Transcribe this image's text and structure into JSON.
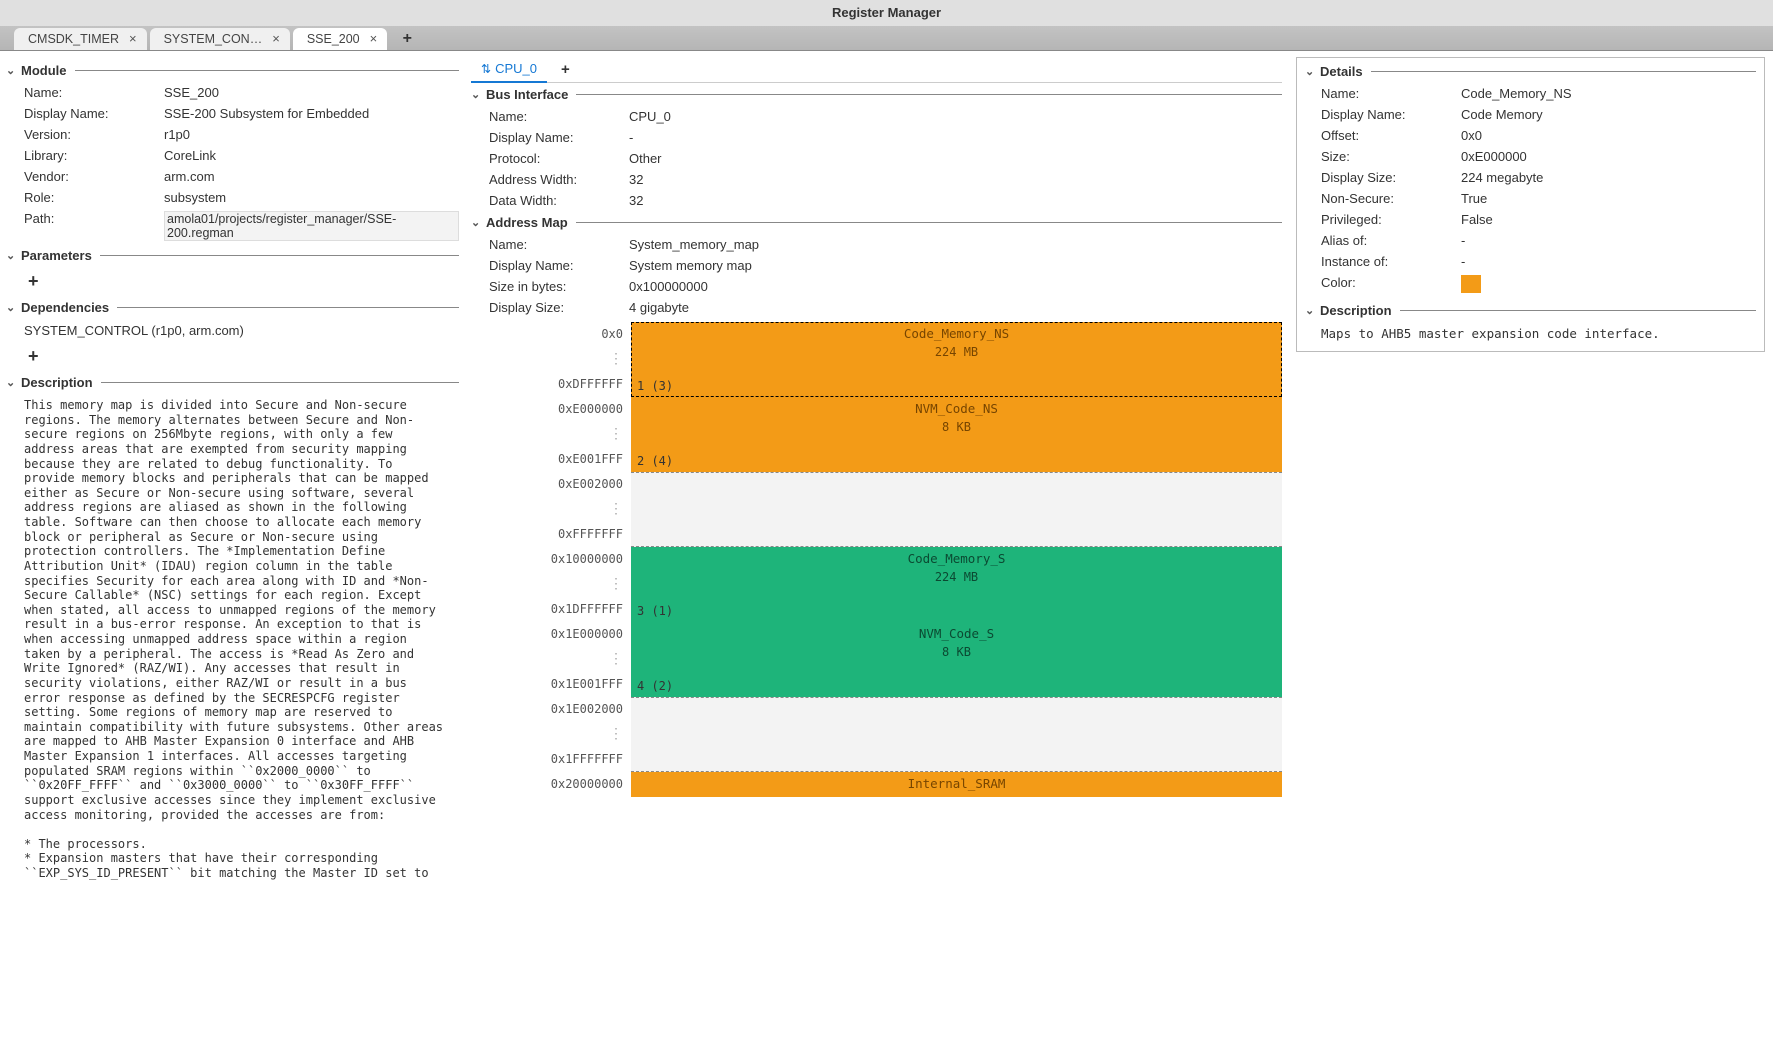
{
  "window": {
    "title": "Register Manager"
  },
  "tabs": [
    {
      "label": "CMSDK_TIMER",
      "active": false
    },
    {
      "label": "SYSTEM_CON…",
      "active": false
    },
    {
      "label": "SSE_200",
      "active": true
    }
  ],
  "module": {
    "header": "Module",
    "name_label": "Name:",
    "name": "SSE_200",
    "display_label": "Display Name:",
    "display": "SSE-200 Subsystem for Embedded",
    "version_label": "Version:",
    "version": "r1p0",
    "library_label": "Library:",
    "library": "CoreLink",
    "vendor_label": "Vendor:",
    "vendor": "arm.com",
    "role_label": "Role:",
    "role": "subsystem",
    "path_label": "Path:",
    "path": "amola01/projects/register_manager/SSE-200.regman"
  },
  "parameters": {
    "header": "Parameters"
  },
  "dependencies": {
    "header": "Dependencies",
    "item": "SYSTEM_CONTROL (r1p0, arm.com)"
  },
  "description": {
    "header": "Description",
    "text": "This memory map is divided into Secure and Non-secure regions. The memory alternates between Secure and Non-secure regions on 256Mbyte regions, with only a few address areas that are exempted from security mapping because they are related to debug functionality. To provide memory blocks and peripherals that can be mapped either as Secure or Non-secure using software, several address regions are aliased as shown in the following table. Software can then choose to allocate each memory block or peripheral as Secure or Non-secure using protection controllers. The *Implementation Define Attribution Unit* (IDAU) region column in the table specifies Security for each area along with ID and *Non-Secure Callable* (NSC) settings for each region. Except when stated, all access to unmapped regions of the memory result in a bus-error response. An exception to that is when accessing unmapped address space within a region taken by a peripheral. The access is *Read As Zero and Write Ignored* (RAZ/WI). Any accesses that result in security violations, either RAZ/WI or result in a bus error response as defined by the SECRESPCFG register setting. Some regions of memory map are reserved to maintain compatibility with future subsystems. Other areas are mapped to AHB Master Expansion 0 interface and AHB Master Expansion 1 interfaces. All accesses targeting populated SRAM regions within ``0x2000_0000`` to ``0x20FF_FFFF`` and ``0x3000_0000`` to ``0x30FF_FFFF`` support exclusive accesses since they implement exclusive access monitoring, provided the accesses are from:\n\n* The processors.\n* Expansion masters that have their corresponding ``EXP_SYS_ID_PRESENT`` bit matching the Master ID set to"
  },
  "cpu_tab": {
    "label": "CPU_0"
  },
  "bus": {
    "header": "Bus Interface",
    "name_label": "Name:",
    "name": "CPU_0",
    "display_label": "Display Name:",
    "display": "-",
    "protocol_label": "Protocol:",
    "protocol": "Other",
    "awidth_label": "Address Width:",
    "awidth": "32",
    "dwidth_label": "Data Width:",
    "dwidth": "32"
  },
  "addrmap": {
    "header": "Address Map",
    "name_label": "Name:",
    "name": "System_memory_map",
    "display_label": "Display Name:",
    "display": "System memory map",
    "size_label": "Size in bytes:",
    "size": "0x100000000",
    "dsize_label": "Display Size:",
    "dsize": "4 gigabyte",
    "addrs": [
      "0x0",
      "⋮",
      "0xDFFFFFF",
      "0xE000000",
      "⋮",
      "0xE001FFF",
      "0xE002000",
      "⋮",
      "0xFFFFFFF",
      "0x10000000",
      "⋮",
      "0x1DFFFFFF",
      "0x1E000000",
      "⋮",
      "0x1E001FFF",
      "0x1E002000",
      "⋮",
      "0x1FFFFFFF",
      "0x20000000"
    ],
    "segs": [
      {
        "name": "Code_Memory_NS",
        "size": "224 MB",
        "badge": "1 (3)",
        "cls": "orange sel"
      },
      {
        "name": "NVM_Code_NS",
        "size": "8 KB",
        "badge": "2 (4)",
        "cls": "orange"
      },
      {
        "gap": true
      },
      {
        "name": "Code_Memory_S",
        "size": "224 MB",
        "badge": "3 (1)",
        "cls": "green"
      },
      {
        "name": "NVM_Code_S",
        "size": "8 KB",
        "badge": "4 (2)",
        "cls": "green"
      },
      {
        "gap": true
      },
      {
        "name": "Internal_SRAM",
        "size": "",
        "badge": "",
        "cls": "orange",
        "half": true
      }
    ]
  },
  "details": {
    "header": "Details",
    "name_label": "Name:",
    "name": "Code_Memory_NS",
    "display_label": "Display Name:",
    "display": "Code Memory",
    "offset_label": "Offset:",
    "offset": "0x0",
    "size_label": "Size:",
    "size": "0xE000000",
    "dsize_label": "Display Size:",
    "dsize": "224 megabyte",
    "ns_label": "Non-Secure:",
    "ns": "True",
    "priv_label": "Privileged:",
    "priv": "False",
    "alias_label": "Alias of:",
    "alias": "-",
    "inst_label": "Instance of:",
    "inst": "-",
    "color_label": "Color:",
    "color": "#f39b17",
    "desc_header": "Description",
    "desc": "Maps to AHB5 master expansion code interface."
  }
}
